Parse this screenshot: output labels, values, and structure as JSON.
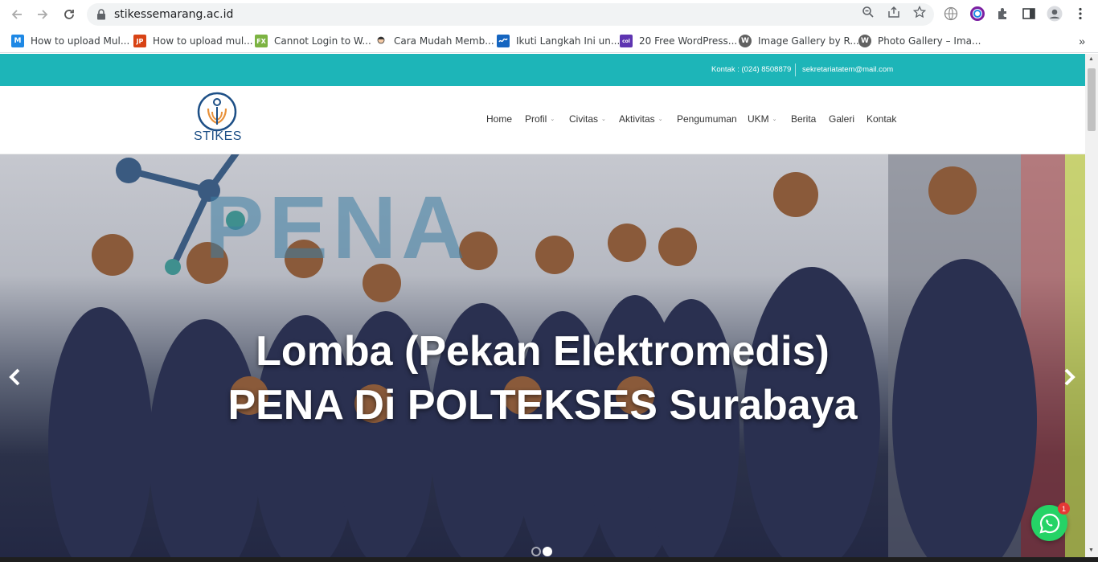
{
  "browser": {
    "url": "stikessemarang.ac.id",
    "bookmarks": [
      {
        "label": "How to upload Mul...",
        "favicon": "M",
        "color": "#1e88e5"
      },
      {
        "label": "How to upload mul...",
        "favicon": "JP",
        "color": "#d84315"
      },
      {
        "label": "Cannot Login to W...",
        "favicon": "FX",
        "color": "#7cb342"
      },
      {
        "label": "Cara Mudah Memb...",
        "favicon": "",
        "color": "#ffffff"
      },
      {
        "label": "Ikuti Langkah Ini un...",
        "favicon": "~",
        "color": "#1565c0"
      },
      {
        "label": "20 Free WordPress...",
        "favicon": "col",
        "color": "#5e35b1"
      },
      {
        "label": "Image Gallery by R...",
        "favicon": "W",
        "color": "#616161"
      },
      {
        "label": "Photo Gallery – Ima...",
        "favicon": "W",
        "color": "#616161"
      }
    ],
    "overflow": "»"
  },
  "topbar": {
    "phone": "Kontak : (024) 8508879",
    "email": "sekretariatatem@mail.com"
  },
  "header": {
    "logo_text": "STIKES",
    "menu": [
      {
        "label": "Home",
        "dropdown": false
      },
      {
        "label": "Profil",
        "dropdown": true
      },
      {
        "label": "Civitas",
        "dropdown": true
      },
      {
        "label": "Aktivitas",
        "dropdown": true
      },
      {
        "label": "Pengumuman",
        "dropdown": false
      },
      {
        "label": "UKM",
        "dropdown": true
      },
      {
        "label": "Berita",
        "dropdown": false
      },
      {
        "label": "Galeri",
        "dropdown": false
      },
      {
        "label": "Kontak",
        "dropdown": false
      }
    ]
  },
  "hero": {
    "banner_word": "PENA",
    "title_line1": "Lomba (Pekan Elektromedis)",
    "title_line2": "PENA Di POLTEKSES Surabaya"
  },
  "whatsapp": {
    "badge": "1"
  },
  "colors": {
    "accent": "#1db5b8",
    "logo_blue": "#1d4f86",
    "logo_orange": "#e8913a",
    "whatsapp": "#25d366"
  }
}
